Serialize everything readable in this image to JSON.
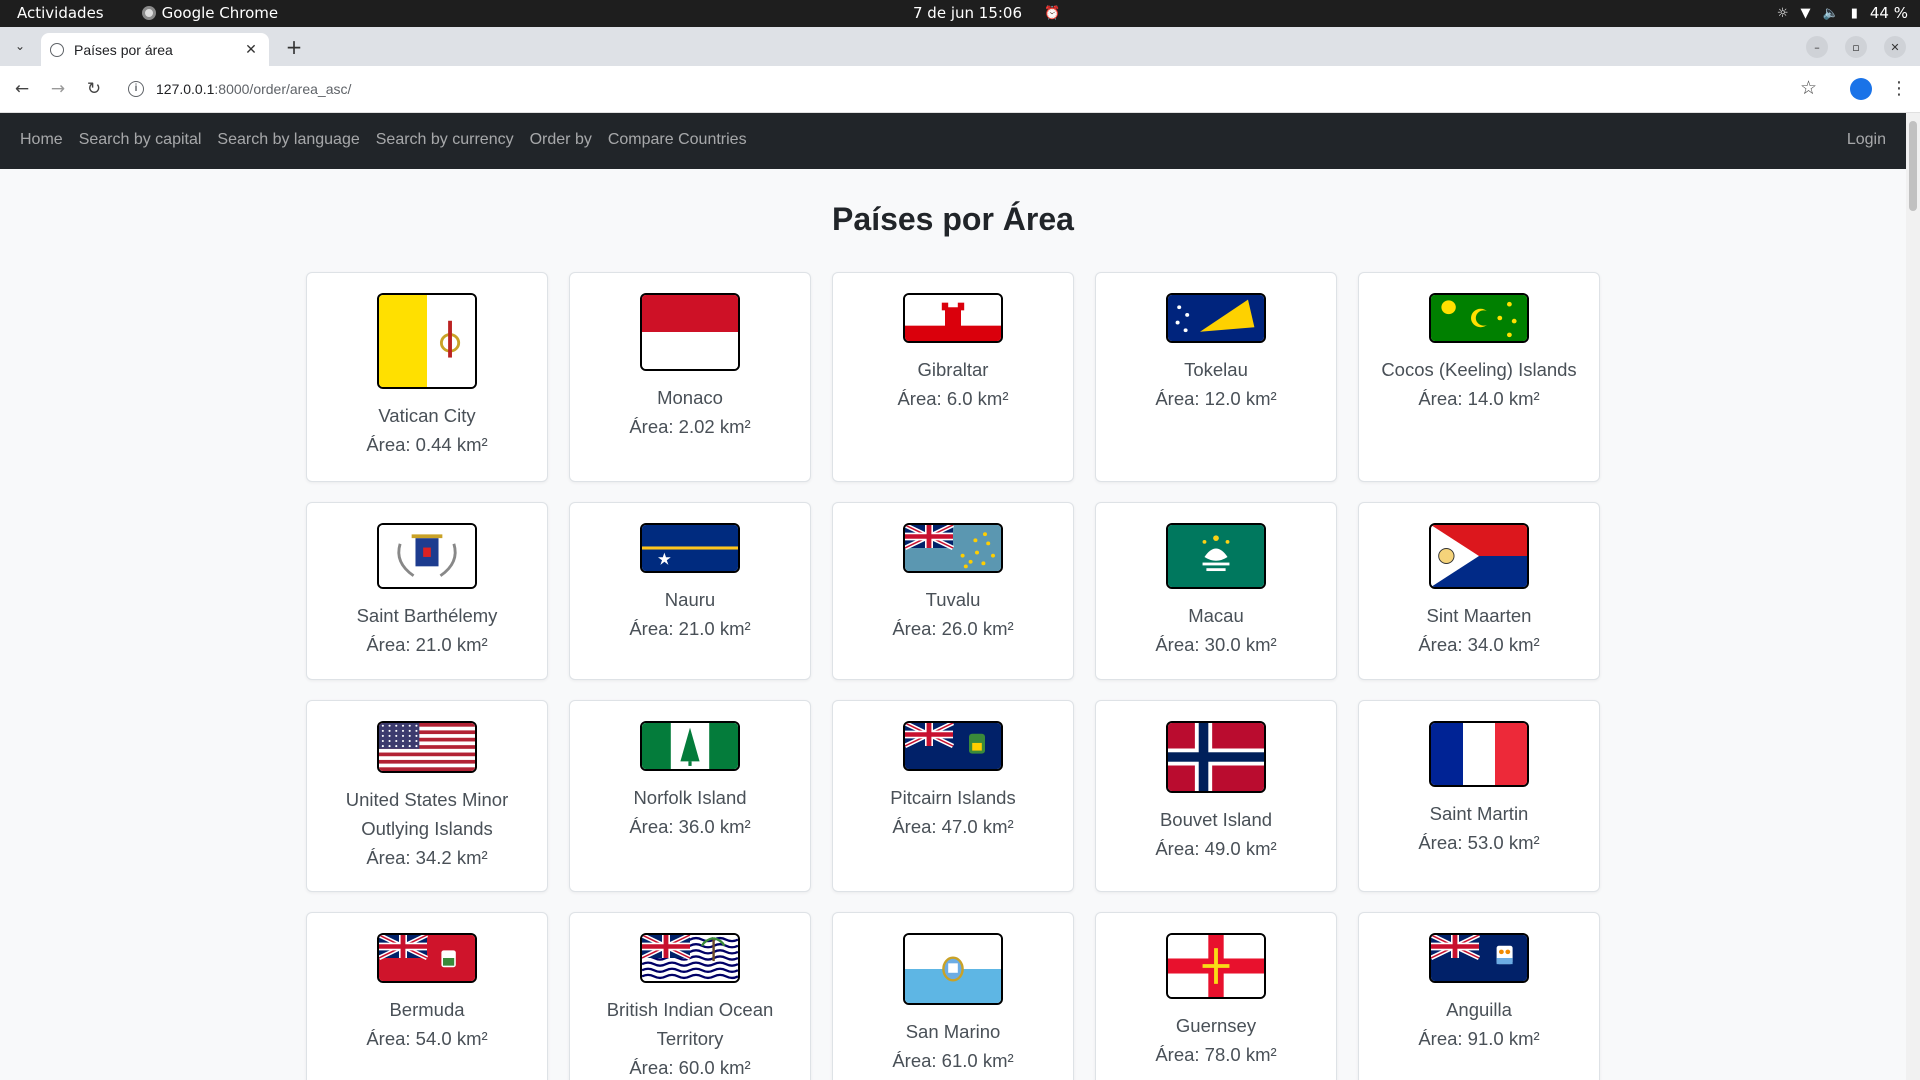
{
  "system": {
    "activities": "Actividades",
    "app_name": "Google Chrome",
    "clock": "7 de jun  15:06",
    "battery": "44 %"
  },
  "browser": {
    "tab_title": "Países por área",
    "url_host": "127.0.0.1",
    "url_path": ":8000/order/area_asc/"
  },
  "navbar": {
    "links": [
      "Home",
      "Search by capital",
      "Search by language",
      "Search by currency",
      "Order by",
      "Compare Countries"
    ],
    "login": "Login"
  },
  "page_title": "Países por Área",
  "countries": [
    {
      "name": "Vatican City",
      "area": "Área: 0.44 km²",
      "flag": "vatican-flag"
    },
    {
      "name": "Monaco",
      "area": "Área: 2.02 km²",
      "flag": "monaco-flag"
    },
    {
      "name": "Gibraltar",
      "area": "Área: 6.0 km²",
      "flag": "gibraltar-flag"
    },
    {
      "name": "Tokelau",
      "area": "Área: 12.0 km²",
      "flag": "tokelau-flag"
    },
    {
      "name": "Cocos (Keeling) Islands",
      "area": "Área: 14.0 km²",
      "flag": "cocos-islands-flag"
    },
    {
      "name": "Saint Barthélemy",
      "area": "Área: 21.0 km²",
      "flag": "saint-barthelemy-flag"
    },
    {
      "name": "Nauru",
      "area": "Área: 21.0 km²",
      "flag": "nauru-flag"
    },
    {
      "name": "Tuvalu",
      "area": "Área: 26.0 km²",
      "flag": "tuvalu-flag"
    },
    {
      "name": "Macau",
      "area": "Área: 30.0 km²",
      "flag": "macau-flag"
    },
    {
      "name": "Sint Maarten",
      "area": "Área: 34.0 km²",
      "flag": "sint-maarten-flag"
    },
    {
      "name": "United States Minor Outlying Islands",
      "area": "Área: 34.2 km²",
      "flag": "us-minor-islands-flag"
    },
    {
      "name": "Norfolk Island",
      "area": "Área: 36.0 km²",
      "flag": "norfolk-island-flag"
    },
    {
      "name": "Pitcairn Islands",
      "area": "Área: 47.0 km²",
      "flag": "pitcairn-islands-flag"
    },
    {
      "name": "Bouvet Island",
      "area": "Área: 49.0 km²",
      "flag": "bouvet-island-flag"
    },
    {
      "name": "Saint Martin",
      "area": "Área: 53.0 km²",
      "flag": "saint-martin-flag"
    },
    {
      "name": "Bermuda",
      "area": "Área: 54.0 km²",
      "flag": "bermuda-flag"
    },
    {
      "name": "British Indian Ocean Territory",
      "area": "Área: 60.0 km²",
      "flag": "british-indian-ocean-territory-flag"
    },
    {
      "name": "San Marino",
      "area": "Área: 61.0 km²",
      "flag": "san-marino-flag"
    },
    {
      "name": "Guernsey",
      "area": "Área: 78.0 km²",
      "flag": "guernsey-flag"
    },
    {
      "name": "Anguilla",
      "area": "Área: 91.0 km²",
      "flag": "anguilla-flag"
    }
  ]
}
